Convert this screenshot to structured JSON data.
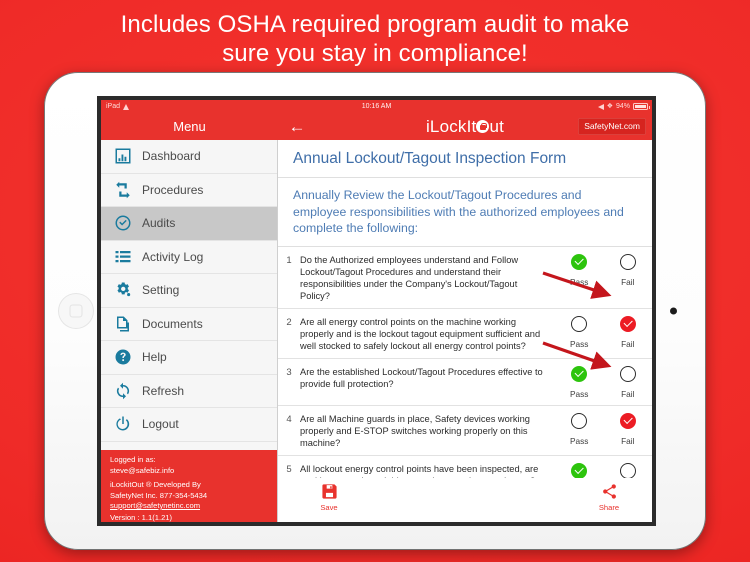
{
  "promo": {
    "line1": "Includes OSHA required program audit to make",
    "line2": "sure you stay in compliance!"
  },
  "statusbar": {
    "device": "iPad",
    "wifi_icon": "wifi-icon",
    "time": "10:16 AM",
    "location_icon": "location-arrow-icon",
    "bluetooth_icon": "bluetooth-icon",
    "battery_percent": "94%"
  },
  "navbar": {
    "menu_label": "Menu",
    "back_icon": "back-arrow-icon",
    "logo_prefix": "iLockIt",
    "logo_lock_icon": "lock-icon",
    "logo_suffix": "ut",
    "safetynet_button": "SafetyNet.com"
  },
  "sidebar": {
    "items": [
      {
        "label": "Dashboard",
        "icon": "bar-chart-icon",
        "active": false
      },
      {
        "label": "Procedures",
        "icon": "refresh-arrows-icon",
        "active": false
      },
      {
        "label": "Audits",
        "icon": "check-circle-icon",
        "active": true
      },
      {
        "label": "Activity Log",
        "icon": "list-icon",
        "active": false
      },
      {
        "label": "Setting",
        "icon": "gears-icon",
        "active": false
      },
      {
        "label": "Documents",
        "icon": "documents-icon",
        "active": false
      },
      {
        "label": "Help",
        "icon": "question-circle-icon",
        "active": false
      },
      {
        "label": "Refresh",
        "icon": "refresh-icon",
        "active": false
      },
      {
        "label": "Logout",
        "icon": "power-icon",
        "active": false
      }
    ],
    "login": {
      "logged_in_label": "Logged in as:",
      "email": "steve@safebiz.info",
      "developed_by": "iLockitOut ® Developed By",
      "company_phone": "SafetyNet Inc. 877-354-5434",
      "support_email": "support@safetynetinc.com",
      "version": "Version : 1.1(1.21)"
    }
  },
  "form": {
    "title": "Annual Lockout/Tagout Inspection Form",
    "intro": "Annually Review the Lockout/Tagout Procedures and employee responsibilities with the authorized employees and complete the following:",
    "pass_label": "Pass",
    "fail_label": "Fail",
    "questions": [
      {
        "num": "1",
        "text": "Do the Authorized employees understand and Follow Lockout/Tagout Procedures and understand their responsibilities under the Company's Lockout/Tagout Policy?",
        "answer": "pass"
      },
      {
        "num": "2",
        "text": "Are all energy control points on the machine working properly and is the lockout tagout equipment sufficient and well stocked to safely lockout all energy control points?",
        "answer": "fail"
      },
      {
        "num": "3",
        "text": "Are the established Lockout/Tagout Procedures effective to provide full protection?",
        "answer": "pass"
      },
      {
        "num": "4",
        "text": "Are all Machine guards in place, Safety devices working properly and E-STOP switches working properly on this machine?",
        "answer": "fail"
      },
      {
        "num": "5",
        "text": "All lockout energy control points have been inspected, are working properly and this procedure requires no change?",
        "answer": "pass"
      }
    ]
  },
  "toolbar": {
    "save_label": "Save",
    "save_icon": "floppy-disk-icon",
    "share_label": "Share",
    "share_icon": "share-nodes-icon"
  },
  "annotations": {
    "arrow_color": "#c4161c",
    "arrows": [
      {
        "name": "arrow-to-q2-fail"
      },
      {
        "name": "arrow-to-q4-fail"
      }
    ]
  },
  "colors": {
    "brand_red": "#e8322d",
    "background_red": "#ef2b28",
    "icon_teal": "#1a7b9e",
    "form_blue": "#3f6ea8",
    "pass_green": "#2dc40d",
    "fail_red": "#ec1c24"
  }
}
